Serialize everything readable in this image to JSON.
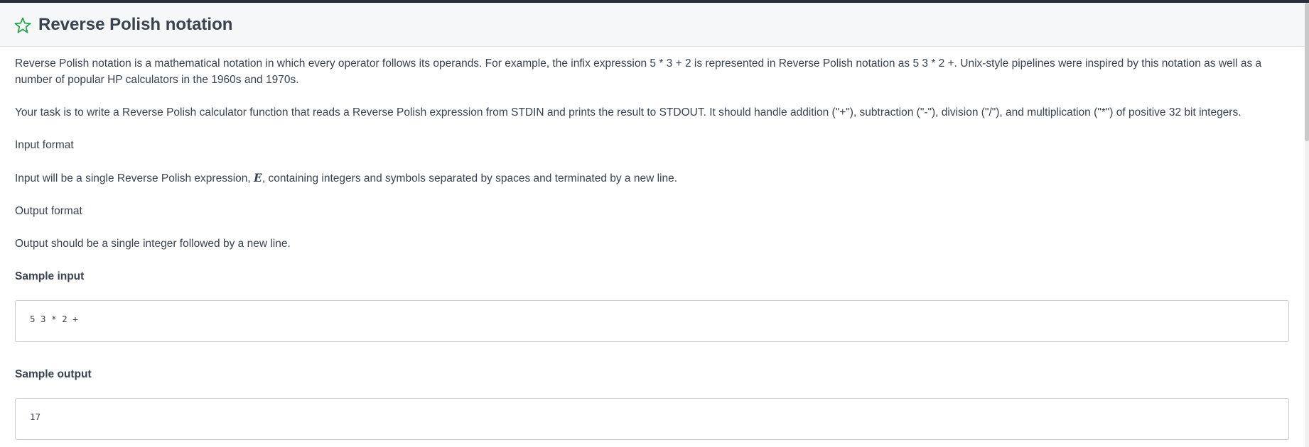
{
  "header": {
    "title": "Reverse Polish notation",
    "star_icon": "star-outline-icon",
    "star_color": "#1ba94c"
  },
  "problem": {
    "intro": "Reverse Polish notation is a mathematical notation in which every operator follows its operands. For example, the infix expression 5 * 3 + 2 is represented in Reverse Polish notation as 5 3 * 2 +. Unix-style pipelines were inspired by this notation as well as a number of popular HP calculators in the 1960s and 1970s.",
    "task": "Your task is to write a Reverse Polish calculator function that reads a Reverse Polish expression from STDIN and prints the result to STDOUT. It should handle addition (\"+\"), subtraction (\"-\"), division (\"/\"), and multiplication (\"*\") of positive 32 bit integers.",
    "input_format_heading": "Input format",
    "input_format_pre": "Input will be a single Reverse Polish expression, ",
    "input_format_var": "E",
    "input_format_post": ", containing integers and symbols separated by spaces and terminated by a new line.",
    "output_format_heading": "Output format",
    "output_format_text": "Output should be a single integer followed by a new line.",
    "sample_input_heading": "Sample input",
    "sample_input": "5 3 * 2 +",
    "sample_output_heading": "Sample output",
    "sample_output": "17"
  }
}
